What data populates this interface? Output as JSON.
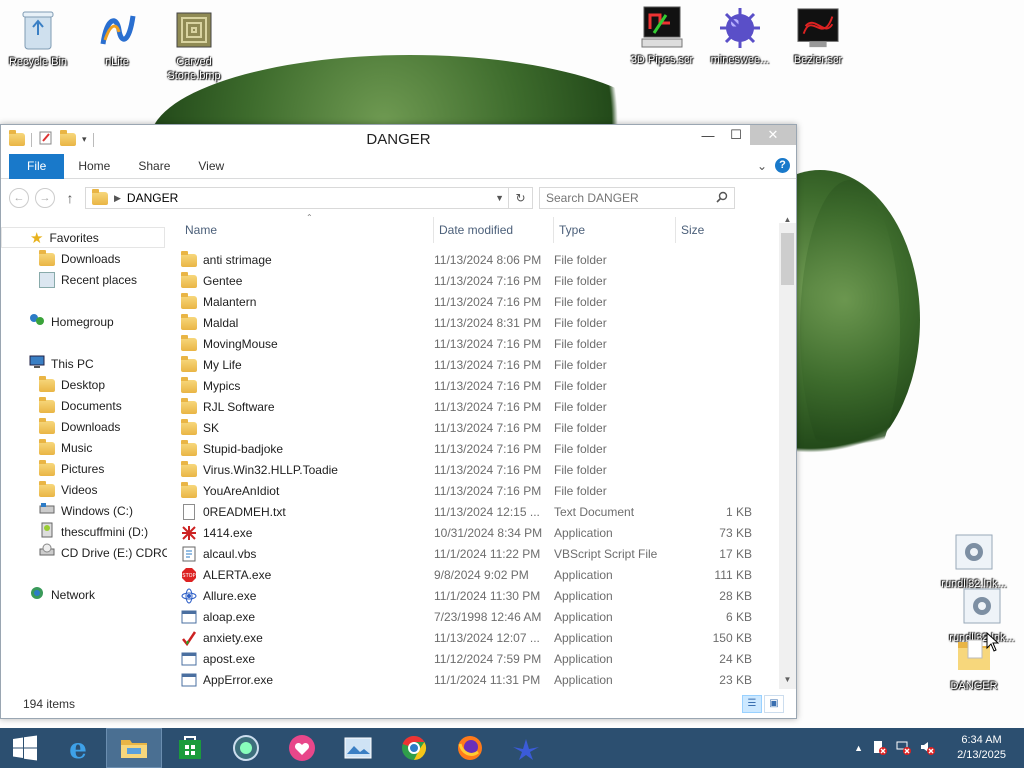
{
  "desktop": {
    "icons": [
      {
        "id": "recycle-bin",
        "label": "Recycle Bin"
      },
      {
        "id": "nlite",
        "label": "nLite"
      },
      {
        "id": "carved-stone",
        "label": "Carved Stone.bmp"
      },
      {
        "id": "3d-pipes",
        "label": "3D Pipes.scr"
      },
      {
        "id": "minesweeper",
        "label": "mineswee..."
      },
      {
        "id": "bezier",
        "label": "Bezier.scr"
      },
      {
        "id": "rundll-1",
        "label": "rundll32.lnk..."
      },
      {
        "id": "rundll-2",
        "label": "rundll32.lnk..."
      },
      {
        "id": "danger",
        "label": "DANGER"
      }
    ]
  },
  "window": {
    "title": "DANGER",
    "minimize": "—",
    "maximize": "☐",
    "close": "✕"
  },
  "ribbon": {
    "tabs": [
      "File",
      "Home",
      "Share",
      "View"
    ],
    "expand": "⌄",
    "help": "?"
  },
  "address": {
    "back": "←",
    "forward": "→",
    "up": "↑",
    "path": "DANGER",
    "refresh": "↻",
    "search_placeholder": "Search DANGER",
    "search_icon": "search-icon"
  },
  "nav": {
    "favorites": "Favorites",
    "downloads": "Downloads",
    "recent": "Recent places",
    "homegroup": "Homegroup",
    "thispc": "This PC",
    "desktop": "Desktop",
    "documents": "Documents",
    "downloads2": "Downloads",
    "music": "Music",
    "pictures": "Pictures",
    "videos": "Videos",
    "windows_c": "Windows (C:)",
    "thescuffmini": "thescuffmini (D:)",
    "cddrive": "CD Drive (E:) CDROM",
    "network": "Network"
  },
  "columns": {
    "name": "Name",
    "date": "Date modified",
    "type": "Type",
    "size": "Size"
  },
  "files": [
    {
      "name": "anti strimage",
      "date": "11/13/2024 8:06 PM",
      "type": "File folder",
      "size": "",
      "icon": "folder"
    },
    {
      "name": "Gentee",
      "date": "11/13/2024 7:16 PM",
      "type": "File folder",
      "size": "",
      "icon": "folder"
    },
    {
      "name": "Malantern",
      "date": "11/13/2024 7:16 PM",
      "type": "File folder",
      "size": "",
      "icon": "folder"
    },
    {
      "name": "Maldal",
      "date": "11/13/2024 8:31 PM",
      "type": "File folder",
      "size": "",
      "icon": "folder"
    },
    {
      "name": "MovingMouse",
      "date": "11/13/2024 7:16 PM",
      "type": "File folder",
      "size": "",
      "icon": "folder"
    },
    {
      "name": "My Life",
      "date": "11/13/2024 7:16 PM",
      "type": "File folder",
      "size": "",
      "icon": "folder"
    },
    {
      "name": "Mypics",
      "date": "11/13/2024 7:16 PM",
      "type": "File folder",
      "size": "",
      "icon": "folder"
    },
    {
      "name": "RJL Software",
      "date": "11/13/2024 7:16 PM",
      "type": "File folder",
      "size": "",
      "icon": "folder"
    },
    {
      "name": "SK",
      "date": "11/13/2024 7:16 PM",
      "type": "File folder",
      "size": "",
      "icon": "folder"
    },
    {
      "name": "Stupid-badjoke",
      "date": "11/13/2024 7:16 PM",
      "type": "File folder",
      "size": "",
      "icon": "folder"
    },
    {
      "name": "Virus.Win32.HLLP.Toadie",
      "date": "11/13/2024 7:16 PM",
      "type": "File folder",
      "size": "",
      "icon": "folder"
    },
    {
      "name": "YouAreAnIdiot",
      "date": "11/13/2024 7:16 PM",
      "type": "File folder",
      "size": "",
      "icon": "folder"
    },
    {
      "name": "0READMEH.txt",
      "date": "11/13/2024 12:15 ...",
      "type": "Text Document",
      "size": "1 KB",
      "icon": "text"
    },
    {
      "name": "1414.exe",
      "date": "10/31/2024 8:34 PM",
      "type": "Application",
      "size": "73 KB",
      "icon": "app-red"
    },
    {
      "name": "alcaul.vbs",
      "date": "11/1/2024 11:22 PM",
      "type": "VBScript Script File",
      "size": "17 KB",
      "icon": "script"
    },
    {
      "name": "ALERTA.exe",
      "date": "9/8/2024 9:02 PM",
      "type": "Application",
      "size": "111 KB",
      "icon": "stop"
    },
    {
      "name": "Allure.exe",
      "date": "11/1/2024 11:30 PM",
      "type": "Application",
      "size": "28 KB",
      "icon": "atom"
    },
    {
      "name": "aloap.exe",
      "date": "7/23/1998 12:46 AM",
      "type": "Application",
      "size": "6 KB",
      "icon": "app"
    },
    {
      "name": "anxiety.exe",
      "date": "11/13/2024 12:07 ...",
      "type": "Application",
      "size": "150 KB",
      "icon": "check"
    },
    {
      "name": "apost.exe",
      "date": "11/12/2024 7:59 PM",
      "type": "Application",
      "size": "24 KB",
      "icon": "app"
    },
    {
      "name": "AppError.exe",
      "date": "11/1/2024 11:31 PM",
      "type": "Application",
      "size": "23 KB",
      "icon": "app"
    }
  ],
  "status": {
    "item_count": "194 items"
  },
  "taskbar": {
    "clock_time": "6:34 AM",
    "clock_date": "2/13/2025",
    "tray_expand": "▲"
  }
}
